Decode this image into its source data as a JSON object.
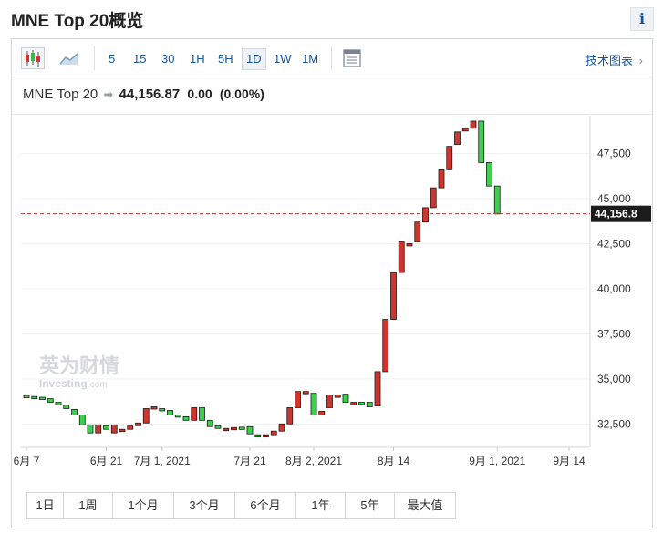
{
  "page": {
    "title": "MNE Top 20概览",
    "info_label": "i"
  },
  "toolbar": {
    "timeframes": [
      "5",
      "15",
      "30",
      "1H",
      "5H",
      "1D",
      "1W",
      "1M"
    ],
    "active_timeframe": "1D",
    "advanced_chart_label": "技术图表",
    "advanced_chart_chevron": "›"
  },
  "quote": {
    "name": "MNE Top 20",
    "arrow": "➡",
    "price": "44,156.87",
    "change": "0.00",
    "change_pct": "(0.00%)"
  },
  "chart_data": {
    "type": "candlestick",
    "y_ticks": [
      32500,
      35000,
      37500,
      40000,
      42500,
      45000,
      47500
    ],
    "y_tick_labels": [
      "32,500",
      "35,000",
      "37,500",
      "40,000",
      "42,500",
      "45,000",
      "47,500"
    ],
    "ylim": [
      31200,
      49600
    ],
    "x_labels": [
      "6月 7",
      "6月 21",
      "7月 1, 2021",
      "7月 21",
      "8月 2, 2021",
      "8月 14",
      "9月 1, 2021",
      "9月 14"
    ],
    "x_label_positions": [
      0,
      10,
      17,
      28,
      36,
      46,
      59,
      68
    ],
    "last_price_label": "44,156.8",
    "last_price": 44156.87,
    "watermark_cn": "英为财情",
    "watermark_en": "Investing",
    "watermark_suffix": ".com",
    "candles": [
      {
        "o": 34080,
        "c": 34030
      },
      {
        "o": 34020,
        "c": 34000
      },
      {
        "o": 33980,
        "c": 33900
      },
      {
        "o": 33900,
        "c": 33700
      },
      {
        "o": 33700,
        "c": 33550
      },
      {
        "o": 33540,
        "c": 33350
      },
      {
        "o": 33300,
        "c": 33000
      },
      {
        "o": 33000,
        "c": 32450
      },
      {
        "o": 32450,
        "c": 32000
      },
      {
        "o": 32000,
        "c": 32450
      },
      {
        "o": 32400,
        "c": 32200
      },
      {
        "o": 32000,
        "c": 32450
      },
      {
        "o": 32200,
        "c": 32200
      },
      {
        "o": 32200,
        "c": 32380
      },
      {
        "o": 32400,
        "c": 32550
      },
      {
        "o": 32550,
        "c": 33350
      },
      {
        "o": 33400,
        "c": 33450
      },
      {
        "o": 33350,
        "c": 33250
      },
      {
        "o": 33250,
        "c": 33000
      },
      {
        "o": 33000,
        "c": 32900
      },
      {
        "o": 32900,
        "c": 32700
      },
      {
        "o": 32700,
        "c": 33400
      },
      {
        "o": 33400,
        "c": 32700
      },
      {
        "o": 32700,
        "c": 32350
      },
      {
        "o": 32400,
        "c": 32250
      },
      {
        "o": 32250,
        "c": 32250
      },
      {
        "o": 32280,
        "c": 32300
      },
      {
        "o": 32320,
        "c": 32300
      },
      {
        "o": 32350,
        "c": 31950
      },
      {
        "o": 31900,
        "c": 31850
      },
      {
        "o": 31900,
        "c": 31900
      },
      {
        "o": 31900,
        "c": 32100
      },
      {
        "o": 32100,
        "c": 32500
      },
      {
        "o": 32500,
        "c": 33400
      },
      {
        "o": 33400,
        "c": 34300
      },
      {
        "o": 34250,
        "c": 34300
      },
      {
        "o": 34200,
        "c": 33000
      },
      {
        "o": 33000,
        "c": 33200
      },
      {
        "o": 33400,
        "c": 34100
      },
      {
        "o": 34100,
        "c": 34100
      },
      {
        "o": 34150,
        "c": 33700
      },
      {
        "o": 33650,
        "c": 33700
      },
      {
        "o": 33700,
        "c": 33650
      },
      {
        "o": 33700,
        "c": 33450
      },
      {
        "o": 33500,
        "c": 35400
      },
      {
        "o": 35400,
        "c": 38300
      },
      {
        "o": 38300,
        "c": 40900
      },
      {
        "o": 40900,
        "c": 42600
      },
      {
        "o": 42500,
        "c": 42500
      },
      {
        "o": 42600,
        "c": 43700
      },
      {
        "o": 43700,
        "c": 44500
      },
      {
        "o": 44500,
        "c": 45600
      },
      {
        "o": 45600,
        "c": 46600
      },
      {
        "o": 46600,
        "c": 47900
      },
      {
        "o": 48000,
        "c": 48700
      },
      {
        "o": 48750,
        "c": 48900
      },
      {
        "o": 48900,
        "c": 49300
      },
      {
        "o": 49300,
        "c": 47000
      },
      {
        "o": 47000,
        "c": 45700
      },
      {
        "o": 45700,
        "c": 44150
      }
    ]
  },
  "range_buttons": [
    "1日",
    "1周",
    "1个月",
    "3个月",
    "6个月",
    "1年",
    "5年",
    "最大值"
  ]
}
